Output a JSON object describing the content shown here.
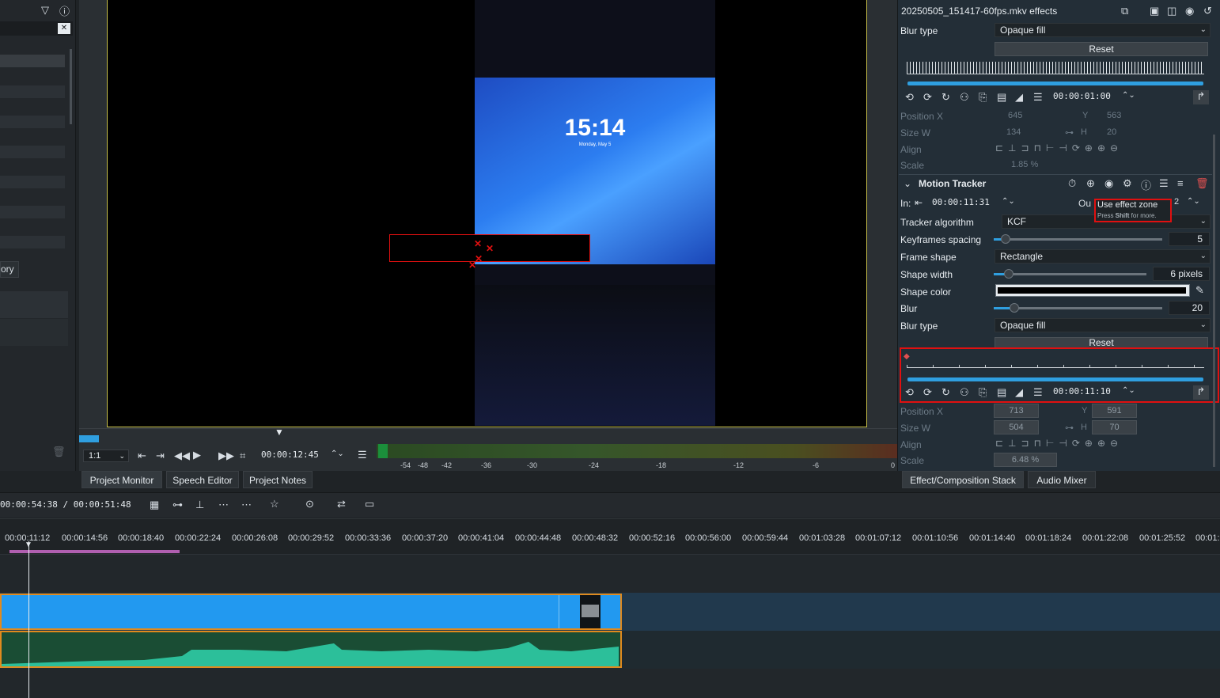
{
  "monitor": {
    "lock_time": "15:14",
    "lock_date": "Monday, May 5",
    "zoom": "1:1",
    "timecode": "00:00:12:45",
    "meter_labels": [
      "-54",
      "-48",
      "-42",
      "-36",
      "-30",
      "-24",
      "-18",
      "-12",
      "-6",
      "0"
    ]
  },
  "monitor_tabs": [
    "Project Monitor",
    "Speech Editor",
    "Project Notes"
  ],
  "left_panel": {
    "partial_button": "ory"
  },
  "effects": {
    "title": "20250505_151417-60fps.mkv effects",
    "blur1": {
      "blur_type_label": "Blur type",
      "blur_type_value": "Opaque fill",
      "reset": "Reset",
      "time": "00:00:01:00",
      "position_x_label": "Position X",
      "position_x": "645",
      "y_label": "Y",
      "y": "563",
      "size_w_label": "Size W",
      "size_w": "134",
      "h_label": "H",
      "h": "20",
      "align_label": "Align",
      "scale_label": "Scale",
      "scale": "1.85 %"
    },
    "tracker": {
      "name": "Motion Tracker",
      "in_label": "In:",
      "in_time": "00:00:11:31",
      "out_label": "Ou",
      "out_val": "2",
      "tooltip_title": "Use effect zone",
      "tooltip_sub_prefix": "Press ",
      "tooltip_sub_bold": "Shift",
      "tooltip_sub_suffix": " for more.",
      "algorithm_label": "Tracker algorithm",
      "algorithm": "KCF",
      "kf_spacing_label": "Keyframes spacing",
      "kf_spacing": "5",
      "frame_shape_label": "Frame shape",
      "frame_shape": "Rectangle",
      "shape_width_label": "Shape width",
      "shape_width": "6 pixels",
      "shape_color_label": "Shape color",
      "blur_label": "Blur",
      "blur": "20",
      "blur_type_label": "Blur type",
      "blur_type": "Opaque fill",
      "reset": "Reset",
      "time": "00:00:11:10",
      "position_x_label": "Position X",
      "position_x": "713",
      "y_label": "Y",
      "y": "591",
      "size_w_label": "Size W",
      "size_w": "504",
      "h_label": "H",
      "h": "70",
      "align_label": "Align",
      "scale_label": "Scale",
      "scale": "6.48 %"
    }
  },
  "right_tabs": [
    "Effect/Composition Stack",
    "Audio Mixer"
  ],
  "timeline": {
    "timecode": "00:00:54:38 / 00:00:51:48",
    "ruler": [
      "00:00:11:12",
      "00:00:14:56",
      "00:00:18:40",
      "00:00:22:24",
      "00:00:26:08",
      "00:00:29:52",
      "00:00:33:36",
      "00:00:37:20",
      "00:00:41:04",
      "00:00:44:48",
      "00:00:48:32",
      "00:00:52:16",
      "00:00:56:00",
      "00:00:59:44",
      "00:01:03:28",
      "00:01:07:12",
      "00:01:10:56",
      "00:01:14:40",
      "00:01:18:24",
      "00:01:22:08",
      "00:01:25:52",
      "00:01:"
    ]
  }
}
